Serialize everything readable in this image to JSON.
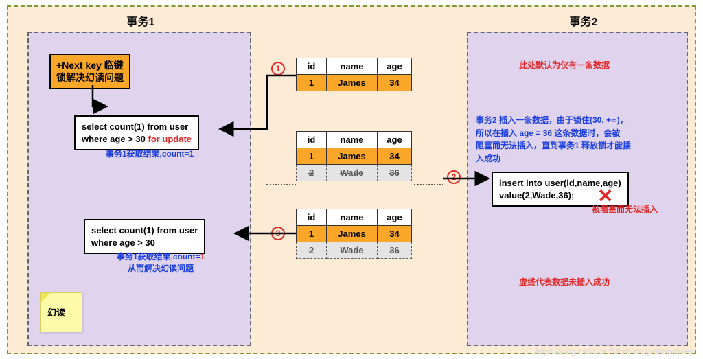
{
  "titles": {
    "tx1": "事务1",
    "tx2": "事务2"
  },
  "key_lock": {
    "l1": "+Next key 临键",
    "l2": "锁解决幻读问题"
  },
  "sql1": {
    "l1": "select count(1) from user",
    "l2a": "where age > 30 ",
    "l2b": "for update"
  },
  "sql1_caption": "事务1获取结果,count=1",
  "sql3": {
    "l1": "select count(1) from user",
    "l2": "where age > 30"
  },
  "sql3_caption_a": "事务1获取结果,count=",
  "sql3_caption_b": "1",
  "sql3_caption_c": "从而解决幻读问题",
  "insert_sql": {
    "l1": "insert into user(id,name,age)",
    "l2": "value(2,Wade,36);"
  },
  "insert_blocked": "被阻塞而无法插入",
  "tx2_top_note": "此处默认为仅有一条数据",
  "tx2_explain": {
    "l1": "事务2 插入一条数据，由于锁住(30, +∞)，",
    "l2": "所以在插入 age = 36 这条数据时，会被",
    "l3": "阻塞而无法插入，直到事务1 释放锁才能插",
    "l4": "入成功"
  },
  "tx2_bottom_note": "虚线代表数据未插入成功",
  "sticky": "幻读",
  "tables": {
    "headers": {
      "id": "id",
      "name": "name",
      "age": "age"
    },
    "row1": {
      "id": "1",
      "name": "James",
      "age": "34"
    },
    "row2": {
      "id": "2",
      "name": "Wade",
      "age": "36"
    }
  },
  "steps": {
    "s1": "1",
    "s2": "2",
    "s3": "3"
  },
  "watermark": "https://blog.csdn.net/Mind_programmonkey"
}
